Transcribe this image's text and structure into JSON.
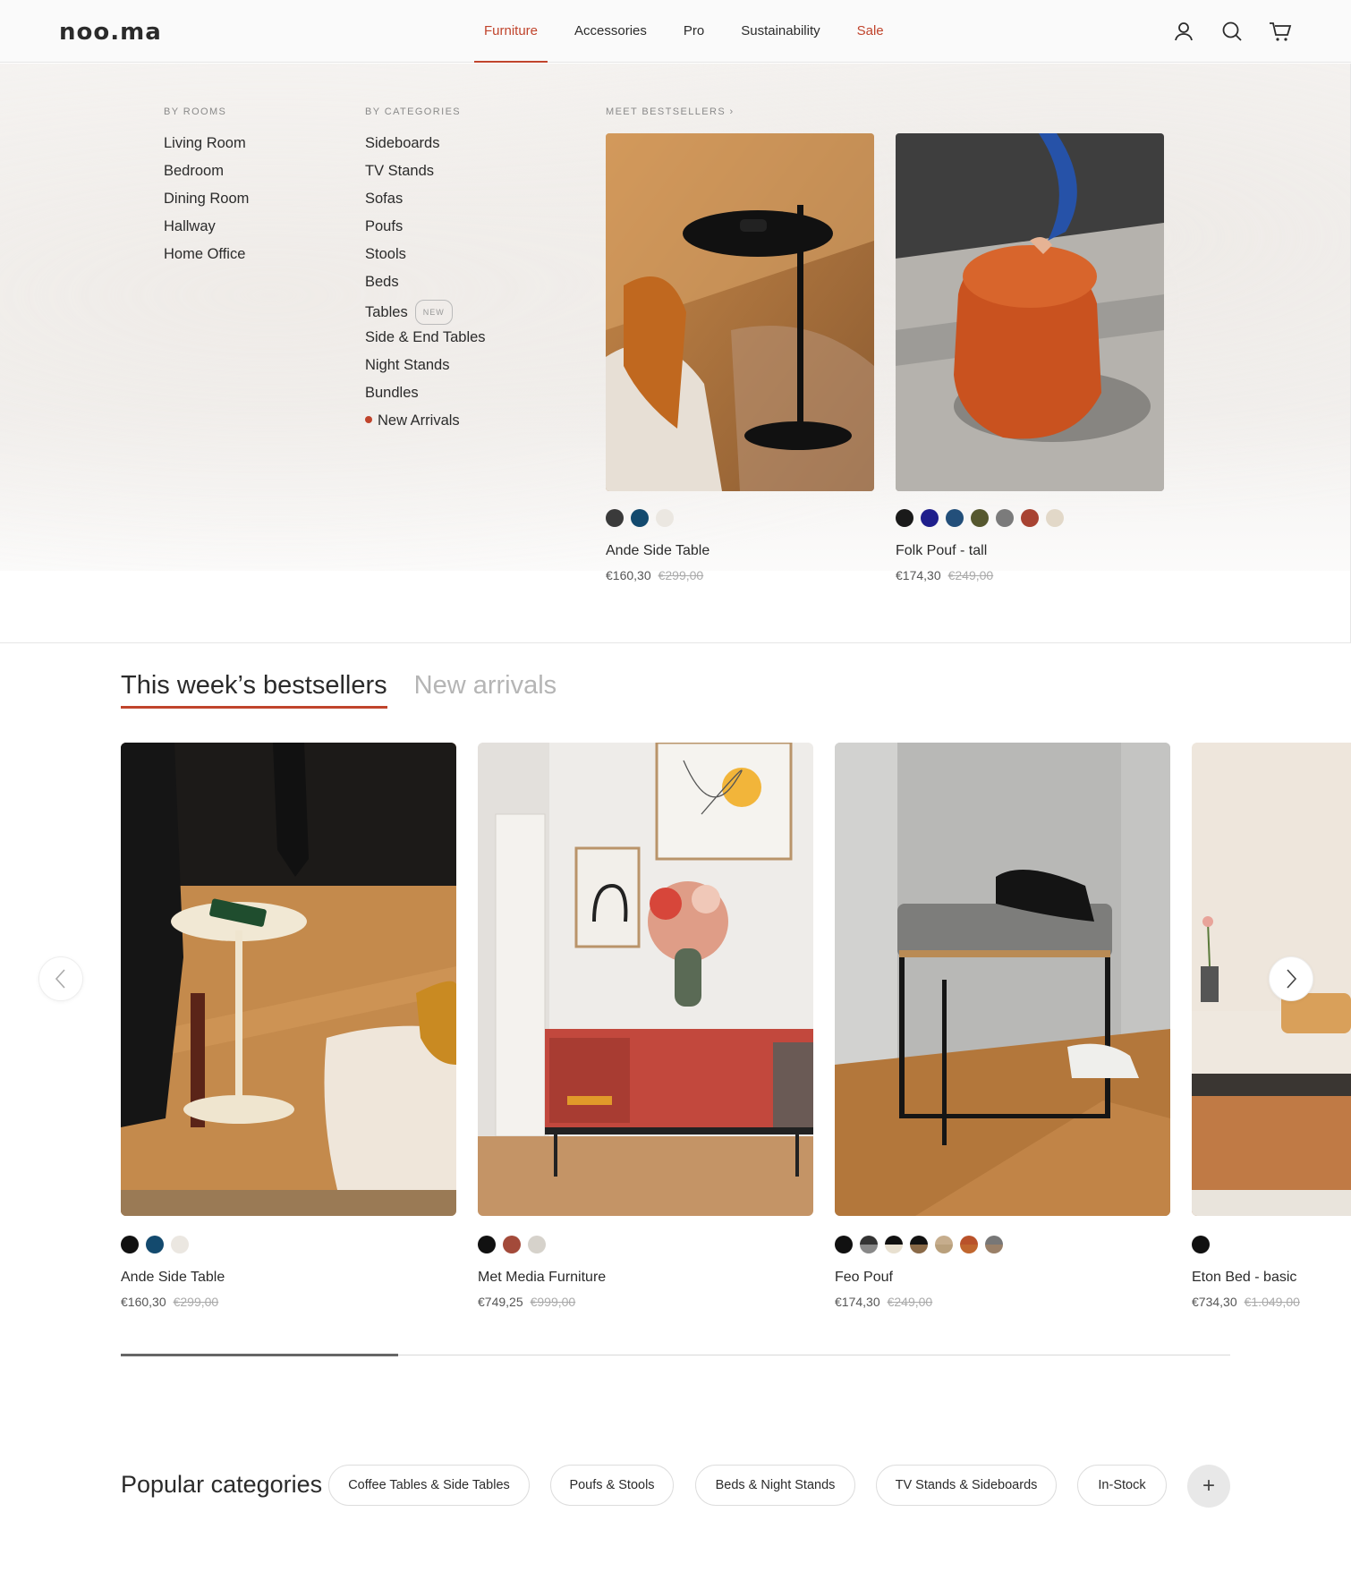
{
  "header": {
    "logo": "noo.ma",
    "nav": [
      {
        "label": "Furniture"
      },
      {
        "label": "Accessories"
      },
      {
        "label": "Pro"
      },
      {
        "label": "Sustainability"
      },
      {
        "label": "Sale"
      }
    ],
    "icons": [
      "user-icon",
      "search-icon",
      "cart-icon"
    ]
  },
  "mega": {
    "rooms_heading": "BY ROOMS",
    "rooms": [
      "Living Room",
      "Bedroom",
      "Dining Room",
      "Hallway",
      "Home Office"
    ],
    "categories_heading": "BY CATEGORIES",
    "categories": [
      "Sideboards",
      "TV Stands",
      "Sofas",
      "Poufs",
      "Stools",
      "Beds",
      "Tables",
      "Side & End Tables",
      "Night Stands",
      "Bundles",
      "New Arrivals"
    ],
    "tables_badge": "NEW",
    "bestsellers_heading": "MEET BESTSELLERS",
    "products": [
      {
        "name": "Ande Side Table",
        "price": "€160,30",
        "old_price": "€299,00",
        "swatches": [
          "#3a3a3a",
          "#134a6e",
          "#ebe7e1"
        ]
      },
      {
        "name": "Folk Pouf - tall",
        "price": "€174,30",
        "old_price": "€249,00",
        "swatches": [
          "#1a1a1a",
          "#1f1f8c",
          "#234f7a",
          "#56582f",
          "#7b7b7b",
          "#a84332",
          "#e2d8c8"
        ]
      }
    ]
  },
  "bestsellers": {
    "tab_active": "This week’s bestsellers",
    "tab_inactive": "New arrivals",
    "products": [
      {
        "name": "Ande Side Table",
        "price": "€160,30",
        "old_price": "€299,00",
        "swatches": [
          "#111111",
          "#134a6e",
          "#ebe7e1"
        ]
      },
      {
        "name": "Met Media Furniture",
        "price": "€749,25",
        "old_price": "€999,00",
        "swatches": [
          "#111111",
          "#a34a3a",
          "#d6d2cb"
        ]
      },
      {
        "name": "Feo Pouf",
        "price": "€174,30",
        "old_price": "€249,00",
        "swatches": [
          "#111111",
          "#555555",
          "#222222",
          "#6b5a48",
          "#c6ad8d",
          "#b9522a",
          "#8a8a8a"
        ]
      },
      {
        "name": "Eton Bed - basic",
        "price": "€734,30",
        "old_price": "€1.049,00",
        "swatches": [
          "#111111"
        ]
      }
    ],
    "scroll_progress": 0.25
  },
  "popular": {
    "heading": "Popular categories",
    "chips": [
      "Coffee Tables & Side Tables",
      "Poufs & Stools",
      "Beds & Night Stands",
      "TV Stands & Sideboards",
      "In-Stock"
    ],
    "more": "+"
  }
}
